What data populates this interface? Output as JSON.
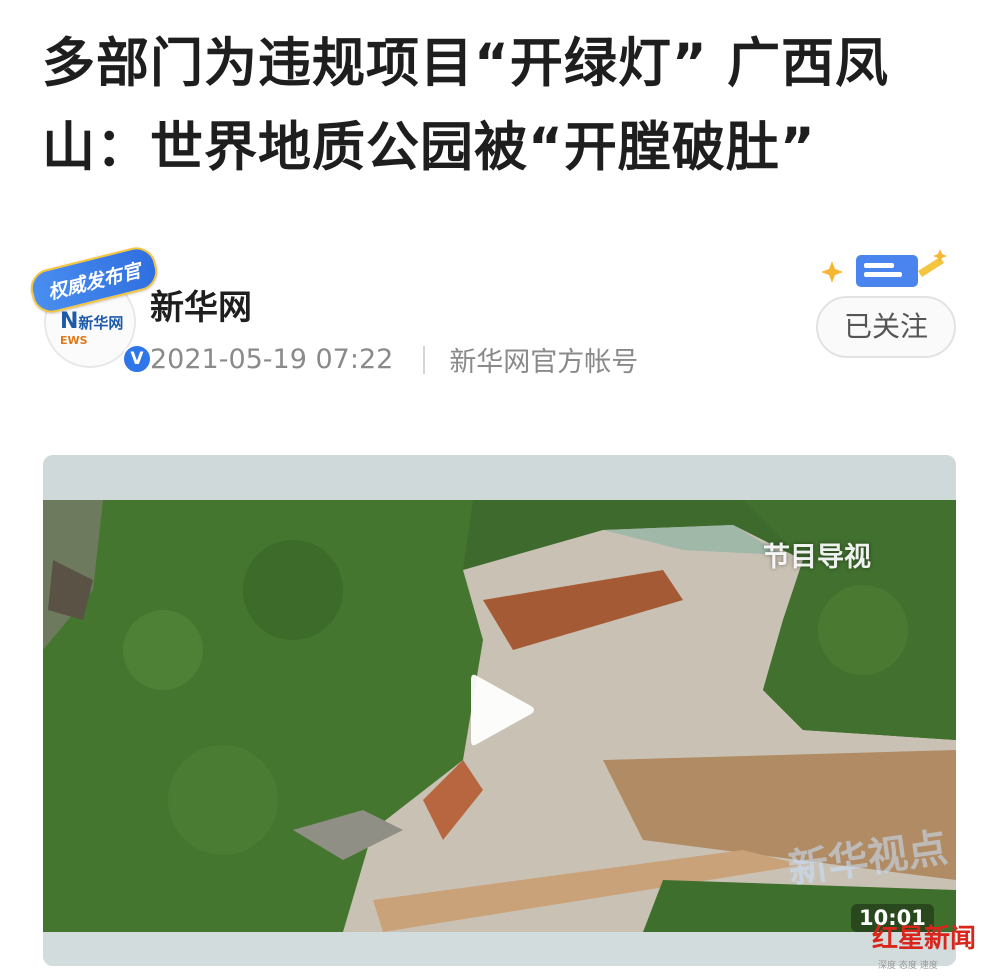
{
  "article": {
    "title": "多部门为违规项目“开绿灯” 广西凤山：世界地质公园被“开膛破肚”"
  },
  "author": {
    "name": "新华网",
    "avatar_badge": "权威发布官",
    "avatar_logo_line1": "新华网",
    "avatar_logo_ews": "EWS",
    "verified_mark": "V",
    "date": "2021-05-19 07:22",
    "account_type": "新华网官方帐号"
  },
  "follow": {
    "label": "已关注"
  },
  "video": {
    "program_guide": "节目导视",
    "duration": "10:01",
    "watermark_xinhua": "新华视点"
  },
  "watermark": {
    "brand": "红星新闻",
    "tagline": "深度 态度 速度"
  },
  "colors": {
    "title": "#1e1e1e",
    "meta": "#8a8a8a",
    "verified": "#2f76e8",
    "brand_red": "#d9261c"
  }
}
